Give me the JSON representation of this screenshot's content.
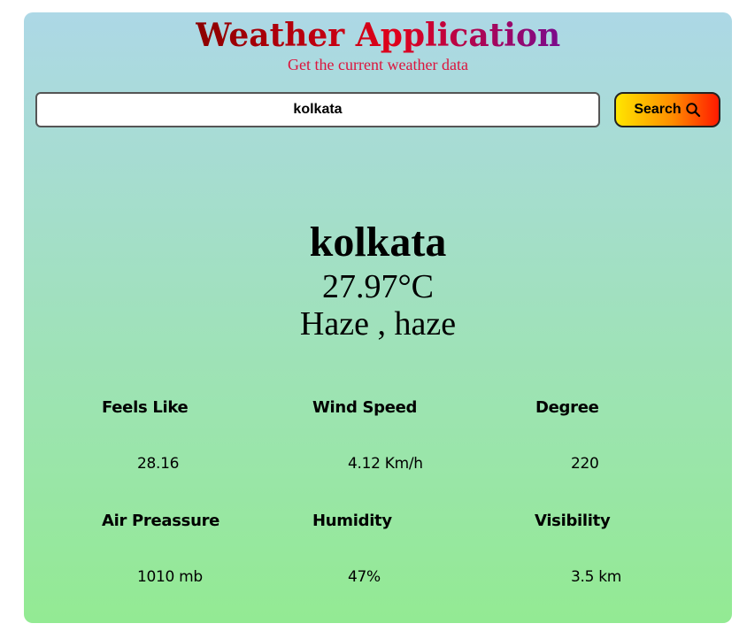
{
  "app": {
    "title": "Weather Application",
    "subtitle": "Get the current weather data"
  },
  "search": {
    "value": "kolkata",
    "button_label": "Search",
    "button_icon": "search-icon"
  },
  "weather": {
    "city": "kolkata",
    "temperature": "27.97°C",
    "condition": "Haze , haze"
  },
  "stats": {
    "feels_like": {
      "label": "Feels Like",
      "value": "28.16"
    },
    "wind_speed": {
      "label": "Wind Speed",
      "value": "4.12 Km/h"
    },
    "degree": {
      "label": "Degree",
      "value": "220"
    },
    "air_pressure": {
      "label": "Air Preassure",
      "value": "1010 mb"
    },
    "humidity": {
      "label": "Humidity",
      "value": "47%"
    },
    "visibility": {
      "label": "Visibility",
      "value": "3.5 km"
    }
  },
  "colors": {
    "background_top": "#add8e6",
    "background_bottom": "#93ea93",
    "subtitle": "#dc143c",
    "button_gradient_start": "#ffe600",
    "button_gradient_end": "#ff1a00"
  }
}
